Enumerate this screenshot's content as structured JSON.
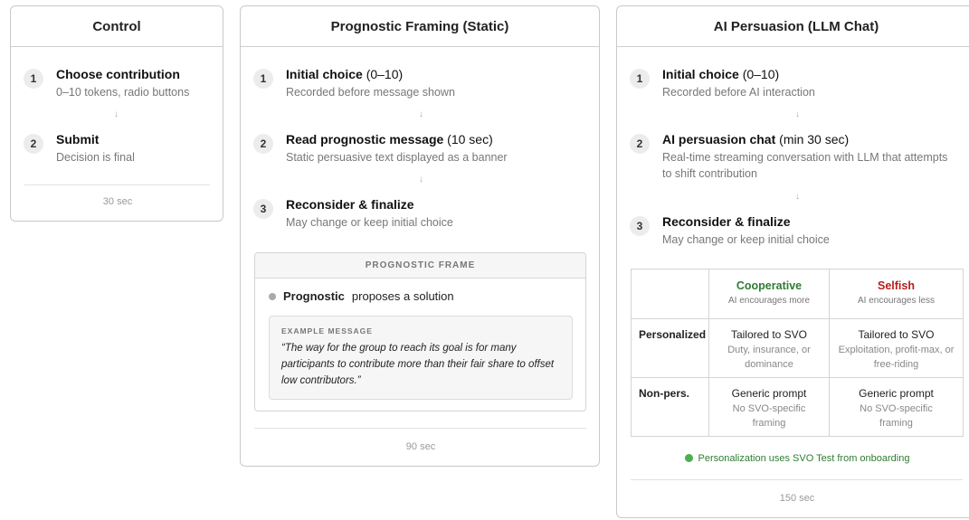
{
  "control": {
    "title": "Control",
    "steps": [
      {
        "num": "1",
        "title": "Choose contribution",
        "desc": "0–10 tokens, radio buttons"
      },
      {
        "num": "2",
        "title": "Submit",
        "desc": "Decision is final"
      }
    ],
    "arrow": "↓",
    "duration": "30 sec"
  },
  "prognostic": {
    "title": "Prognostic Framing (Static)",
    "steps": [
      {
        "num": "1",
        "title": "Initial choice",
        "title_suffix": " (0–10)",
        "desc": "Recorded before message shown"
      },
      {
        "num": "2",
        "title": "Read prognostic message",
        "title_suffix": " (10 sec)",
        "desc": "Static persuasive text displayed as a banner"
      },
      {
        "num": "3",
        "title": "Reconsider & finalize",
        "title_suffix": "",
        "desc": "May change or keep initial choice"
      }
    ],
    "arrow": "↓",
    "frame": {
      "header": "PROGNOSTIC FRAME",
      "label": "Prognostic",
      "label_desc": "proposes a solution",
      "example_label": "EXAMPLE MESSAGE",
      "example_text": "“The way for the group to reach its goal is for many participants to contribute more than their fair share to offset low contributors.”"
    },
    "duration": "90 sec"
  },
  "ai": {
    "title": "AI Persuasion (LLM Chat)",
    "steps": [
      {
        "num": "1",
        "title": "Initial choice",
        "title_suffix": " (0–10)",
        "desc": "Recorded before AI interaction"
      },
      {
        "num": "2",
        "title": "AI persuasion chat",
        "title_suffix": " (min 30 sec)",
        "desc": "Real-time streaming conversation with LLM that attempts to shift contribution"
      },
      {
        "num": "3",
        "title": "Reconsider & finalize",
        "title_suffix": "",
        "desc": "May change or keep initial choice"
      }
    ],
    "arrow": "↓",
    "grid": {
      "columns": [
        {
          "title": "Cooperative",
          "sub": "AI encourages more",
          "color": "#2e7d32"
        },
        {
          "title": "Selfish",
          "sub": "AI encourages less",
          "color": "#b71c1c"
        }
      ],
      "rows": [
        {
          "label": "Personalized",
          "cells": [
            {
              "main": "Tailored to SVO",
              "sub": "Duty, insurance, or dominance"
            },
            {
              "main": "Tailored to SVO",
              "sub": "Exploitation, profit-max, or free-riding"
            }
          ]
        },
        {
          "label": "Non-pers.",
          "cells": [
            {
              "main": "Generic prompt",
              "sub": "No SVO-specific framing"
            },
            {
              "main": "Generic prompt",
              "sub": "No SVO-specific framing"
            }
          ]
        }
      ]
    },
    "note": "Personalization uses SVO Test from onboarding",
    "note_color": "#4caf50",
    "duration": "150 sec"
  },
  "colors": {
    "dot_gray": "#aaaaaa"
  }
}
